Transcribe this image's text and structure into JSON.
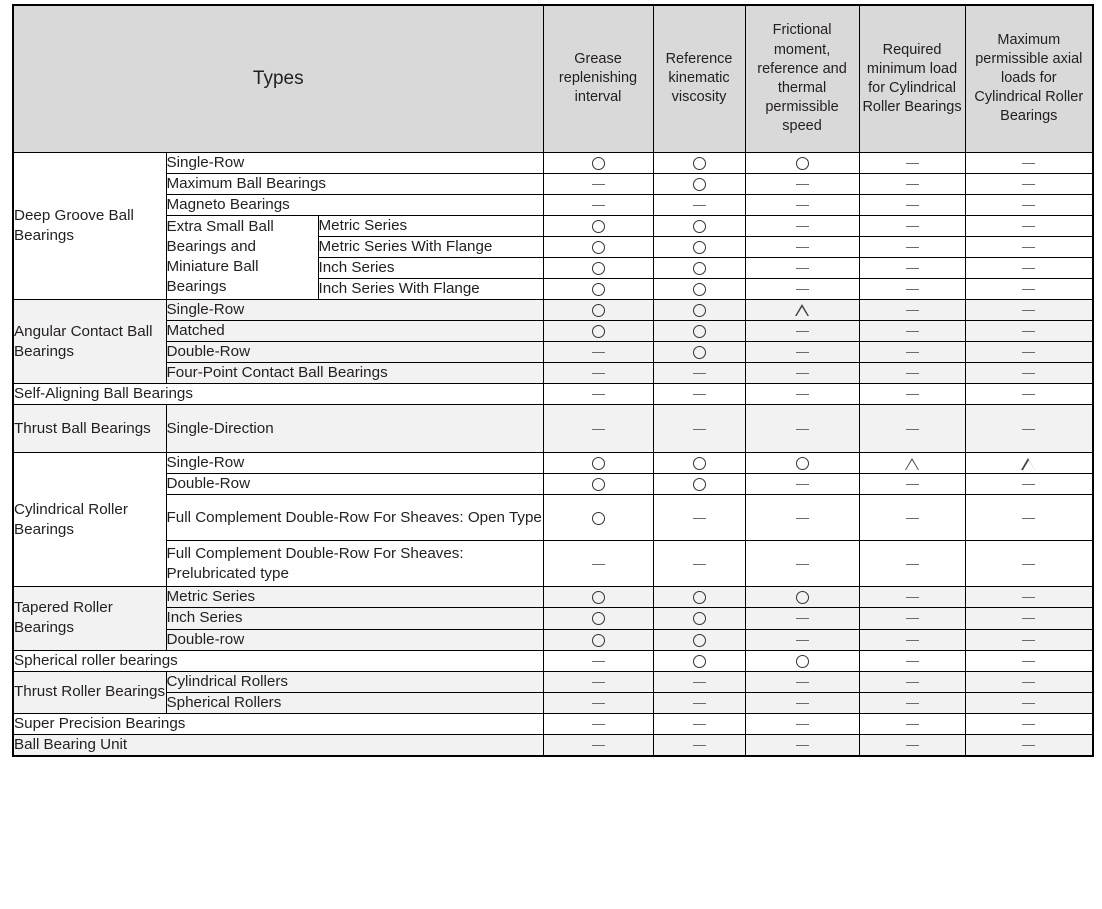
{
  "table": {
    "headers": {
      "types": "Types",
      "cols": [
        "Grease replenishing interval",
        "Reference kinematic viscosity",
        "Frictional moment, reference and thermal permissible speed",
        "Required minimum load for Cylindrical Roller Bearings",
        "Maximum permissible axial loads for Cylindrical Roller Bearings"
      ]
    },
    "symbol_legend": {
      "circle": "○",
      "triangle": "△",
      "dash": "—"
    },
    "colors": {
      "header_bg": "#d9d9d9",
      "band_shade": "#f2f2f2",
      "band_plain": "#ffffff",
      "border": "#000000",
      "text": "#231f20"
    },
    "rows": [
      {
        "g1": "Deep Groove Ball Bearings",
        "g1span": 7,
        "g2": "Single-Row",
        "g2span": 1,
        "g2wide": true,
        "g3": null,
        "marks": [
          "circle",
          "circle",
          "circle",
          "dash",
          "dash"
        ],
        "band": "plain",
        "grptop": true
      },
      {
        "g1": null,
        "g2": "Maximum Ball Bearings",
        "g2span": 1,
        "g2wide": true,
        "g3": null,
        "marks": [
          "dash",
          "circle",
          "dash",
          "dash",
          "dash"
        ],
        "band": "plain"
      },
      {
        "g1": null,
        "g2": "Magneto Bearings",
        "g2span": 1,
        "g2wide": true,
        "g3": null,
        "marks": [
          "dash",
          "dash",
          "dash",
          "dash",
          "dash"
        ],
        "band": "plain"
      },
      {
        "g1": null,
        "g2": "Extra Small Ball Bearings and Miniature Ball Bearings",
        "g2span": 4,
        "g2wide": false,
        "g3": "Metric Series",
        "marks": [
          "circle",
          "circle",
          "dash",
          "dash",
          "dash"
        ],
        "band": "plain"
      },
      {
        "g1": null,
        "g2": null,
        "g3": "Metric Series With Flange",
        "marks": [
          "circle",
          "circle",
          "dash",
          "dash",
          "dash"
        ],
        "band": "plain"
      },
      {
        "g1": null,
        "g2": null,
        "g3": "Inch Series",
        "marks": [
          "circle",
          "circle",
          "dash",
          "dash",
          "dash"
        ],
        "band": "plain"
      },
      {
        "g1": null,
        "g2": null,
        "g3": "Inch Series With Flange",
        "marks": [
          "circle",
          "circle",
          "dash",
          "dash",
          "dash"
        ],
        "band": "plain"
      },
      {
        "g1": "Angular Contact Ball Bearings",
        "g1span": 4,
        "g2": "Single-Row",
        "g2span": 1,
        "g2wide": true,
        "g3": null,
        "marks": [
          "circle",
          "circle",
          "triangle",
          "dash",
          "dash"
        ],
        "band": "shade",
        "grptop": true
      },
      {
        "g1": null,
        "g2": "Matched",
        "g2span": 1,
        "g2wide": true,
        "g3": null,
        "marks": [
          "circle",
          "circle",
          "dash",
          "dash",
          "dash"
        ],
        "band": "shade"
      },
      {
        "g1": null,
        "g2": "Double-Row",
        "g2span": 1,
        "g2wide": true,
        "g3": null,
        "marks": [
          "dash",
          "circle",
          "dash",
          "dash",
          "dash"
        ],
        "band": "shade"
      },
      {
        "g1": null,
        "g2": "Four-Point Contact Ball Bearings",
        "g2span": 1,
        "g2wide": true,
        "g3": null,
        "marks": [
          "dash",
          "dash",
          "dash",
          "dash",
          "dash"
        ],
        "band": "shade"
      },
      {
        "g1": "Self-Aligning Ball Bearings",
        "g1span": 1,
        "g1wide": true,
        "g2": null,
        "g3": null,
        "marks": [
          "dash",
          "dash",
          "dash",
          "dash",
          "dash"
        ],
        "band": "plain",
        "grptop": true
      },
      {
        "g1": "Thrust Ball Bearings",
        "g1span": 1,
        "g2": "Single-Direction",
        "g2span": 1,
        "g2wide": true,
        "g3": null,
        "marks": [
          "dash",
          "dash",
          "dash",
          "dash",
          "dash"
        ],
        "band": "shade",
        "grptop": true,
        "tall": true
      },
      {
        "g1": "Cylindrical Roller Bearings",
        "g1span": 4,
        "g2": "Single-Row",
        "g2span": 1,
        "g2wide": true,
        "g3": null,
        "marks": [
          "circle",
          "circle",
          "circle",
          "triangle",
          "triangle"
        ],
        "band": "plain",
        "grptop": true
      },
      {
        "g1": null,
        "g2": "Double-Row",
        "g2span": 1,
        "g2wide": true,
        "g3": null,
        "marks": [
          "circle",
          "circle",
          "dash",
          "dash",
          "dash"
        ],
        "band": "plain"
      },
      {
        "g1": null,
        "g2": "Full Complement Double-Row For Sheaves: Open Type",
        "g2span": 1,
        "g2wide": true,
        "g3": null,
        "marks": [
          "circle",
          "dash",
          "dash",
          "dash",
          "dash"
        ],
        "band": "plain",
        "tall2": true
      },
      {
        "g1": null,
        "g2": "Full Complement Double-Row For Sheaves: Prelubricated type",
        "g2span": 1,
        "g2wide": true,
        "g3": null,
        "marks": [
          "dash",
          "dash",
          "dash",
          "dash",
          "dash"
        ],
        "band": "plain",
        "tall2": true
      },
      {
        "g1": "Tapered Roller Bearings",
        "g1span": 3,
        "g2": "Metric Series",
        "g2span": 1,
        "g2wide": true,
        "g3": null,
        "marks": [
          "circle",
          "circle",
          "circle",
          "dash",
          "dash"
        ],
        "band": "shade",
        "grptop": true
      },
      {
        "g1": null,
        "g2": "Inch Series",
        "g2span": 1,
        "g2wide": true,
        "g3": null,
        "marks": [
          "circle",
          "circle",
          "dash",
          "dash",
          "dash"
        ],
        "band": "shade"
      },
      {
        "g1": null,
        "g2": "Double-row",
        "g2span": 1,
        "g2wide": true,
        "g3": null,
        "marks": [
          "circle",
          "circle",
          "dash",
          "dash",
          "dash"
        ],
        "band": "shade"
      },
      {
        "g1": "Spherical roller bearings",
        "g1span": 1,
        "g1wide": true,
        "g2": null,
        "g3": null,
        "marks": [
          "dash",
          "circle",
          "circle",
          "dash",
          "dash"
        ],
        "band": "plain",
        "grptop": true
      },
      {
        "g1": "Thrust Roller Bearings",
        "g1span": 2,
        "g2": "Cylindrical Rollers",
        "g2span": 1,
        "g2wide": true,
        "g3": null,
        "marks": [
          "dash",
          "dash",
          "dash",
          "dash",
          "dash"
        ],
        "band": "shade",
        "grptop": true
      },
      {
        "g1": null,
        "g2": "Spherical Rollers",
        "g2span": 1,
        "g2wide": true,
        "g3": null,
        "marks": [
          "dash",
          "dash",
          "dash",
          "dash",
          "dash"
        ],
        "band": "shade"
      },
      {
        "g1": "Super Precision Bearings",
        "g1span": 1,
        "g1wide": true,
        "g2": null,
        "g3": null,
        "marks": [
          "dash",
          "dash",
          "dash",
          "dash",
          "dash"
        ],
        "band": "plain",
        "grptop": true
      },
      {
        "g1": "Ball Bearing Unit",
        "g1span": 1,
        "g1wide": true,
        "g2": null,
        "g3": null,
        "marks": [
          "dash",
          "dash",
          "dash",
          "dash",
          "dash"
        ],
        "band": "shade",
        "grptop": true
      }
    ]
  }
}
